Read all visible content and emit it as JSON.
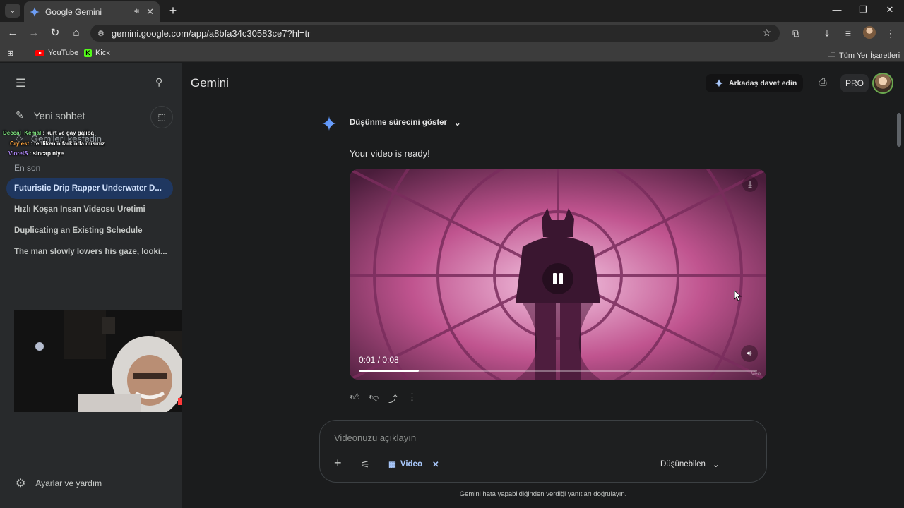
{
  "browser": {
    "tab_title": "Google Gemini",
    "url": "gemini.google.com/app/a8bfa34c30583ce7?hl=tr",
    "bookmarks": [
      "YouTube",
      "Kick"
    ],
    "all_bookmarks": "Tüm Yer İşaretleri"
  },
  "sidebar": {
    "new_chat": "Yeni sohbet",
    "gems": "Gem'leri keşfedin",
    "recent_heading": "En son",
    "history": [
      "Futuristic Drip Rapper Underwater D...",
      "Hızlı Koşan İnsan Videosu Üretimi",
      "Duplicating an Existing Schedule",
      "The man slowly lowers his gaze, looki..."
    ],
    "settings": "Ayarlar ve yardım"
  },
  "overlay_chat": [
    {
      "user": "Deccal_Kemal",
      "msg": " : kürt ve gay galiba"
    },
    {
      "user": "Cryiest",
      "msg": " : tehlikenin farkında mısınız"
    },
    {
      "user": "ViorelS",
      "msg": " : sincap niye"
    }
  ],
  "header": {
    "brand": "Gemini",
    "invite": "Arkadaş davet edin",
    "plan": "PRO"
  },
  "response": {
    "thinking_toggle": "Düşünme sürecini göster",
    "message": "Your video is ready!",
    "video": {
      "timecode": "0:01 / 0:08",
      "progress": 0.15,
      "watermark": "Veo"
    }
  },
  "input": {
    "placeholder": "Videonuzu açıklayın",
    "tool_chip": "Video",
    "model": "Düşünebilen",
    "disclaimer": "Gemini hata yapabildiğinden verdiği yanıtları doğrulayın."
  },
  "colors": {
    "accent": "#a8c7fa",
    "active_history": "#1f3760",
    "video_tint": "#c0548f"
  }
}
